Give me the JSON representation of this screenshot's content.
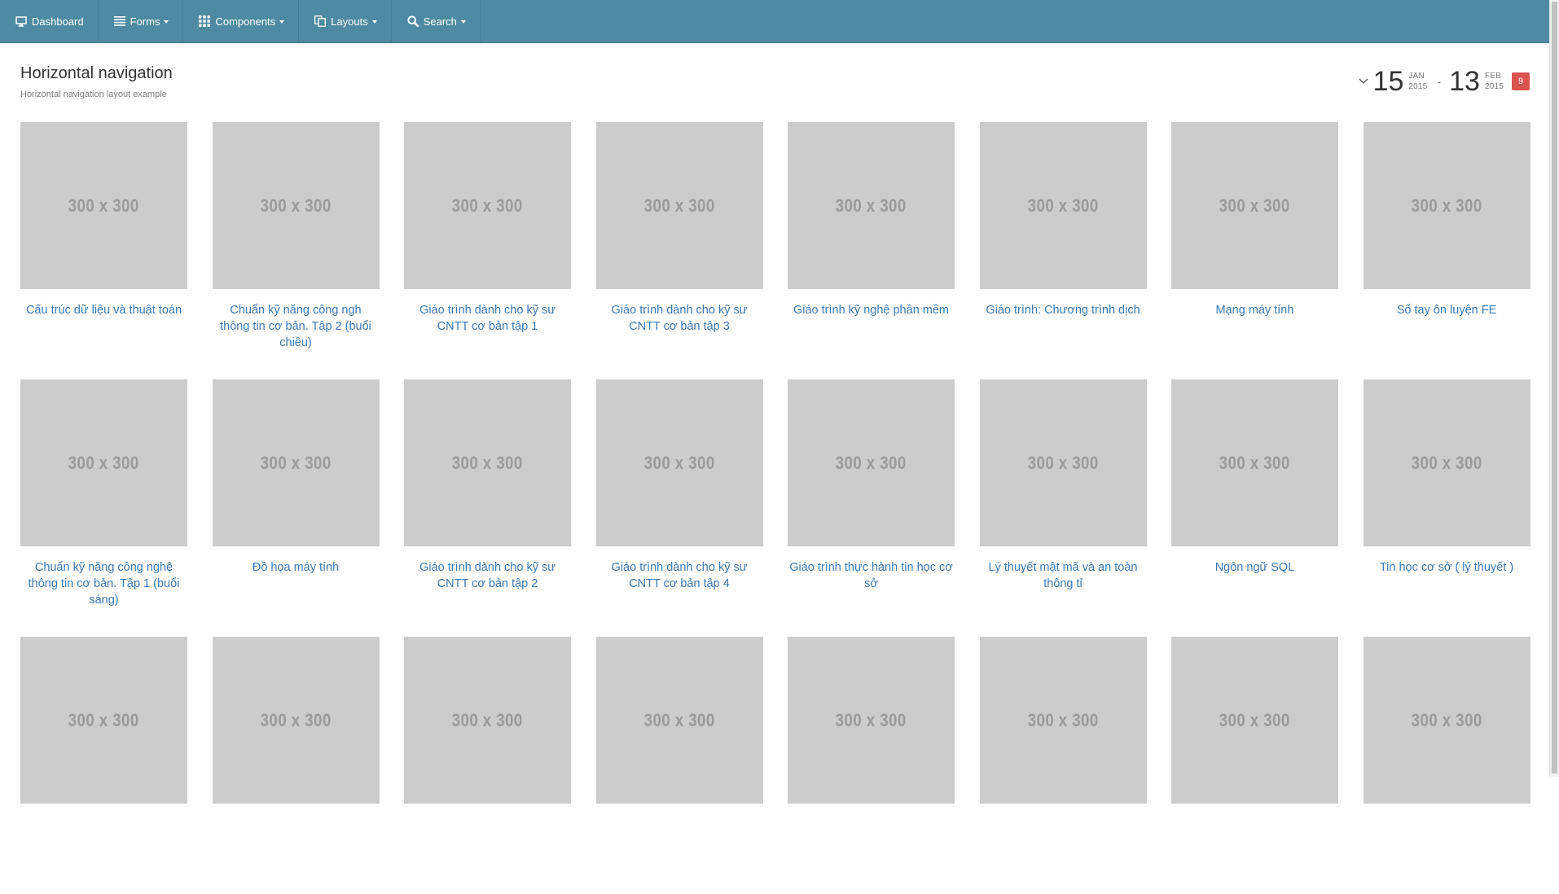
{
  "navbar": {
    "items": [
      {
        "label": "Dashboard",
        "icon": "monitor-icon",
        "dropdown": false
      },
      {
        "label": "Forms",
        "icon": "list-icon",
        "dropdown": true
      },
      {
        "label": "Components",
        "icon": "grid-icon",
        "dropdown": true
      },
      {
        "label": "Layouts",
        "icon": "copy-icon",
        "dropdown": true
      },
      {
        "label": "Search",
        "icon": "search-icon",
        "dropdown": true
      }
    ]
  },
  "header": {
    "title": "Horizontal navigation",
    "subtitle": "Horizontal navigation layout example"
  },
  "daterange": {
    "start_day": "15",
    "start_month": "JAN",
    "start_year": "2015",
    "separator": "-",
    "end_day": "13",
    "end_month": "FEB",
    "end_year": "2015",
    "badge": "9"
  },
  "placeholder_text": "300 x 300",
  "books": [
    "Cấu trúc dữ liệu và thuật toán",
    "Chuẩn kỹ năng công ngh thông tin cơ bản. Tập 2 (buổi chiều)",
    "Giáo trình dành cho kỹ sư CNTT cơ bản tập 1",
    "Giáo trình dành cho kỹ sư CNTT cơ bản tập 3",
    "Giáo trình kỹ nghệ phần mềm",
    "Giáo trình: Chương trình dịch",
    "Mạng máy tính",
    "Sổ tay ôn luyện FE",
    "Chuẩn kỹ năng công nghệ thông tin cơ bản. Tập 1 (buổi sáng)",
    "Đồ họa máy tính",
    "Giáo trình dành cho kỹ sư CNTT cơ bản tập 2",
    "Giáo trình dành cho kỹ sư CNTT cơ bản tập 4",
    "Giáo trình thực hành tin học cơ sở",
    "Lý thuyết mật mã và an toàn thông tỉ",
    "Ngôn ngữ SQL",
    "Tin học cơ sở ( lý thuyết )",
    "",
    "",
    "",
    "",
    "",
    "",
    "",
    ""
  ],
  "colors": {
    "navbar_bg": "#4e8ba2",
    "link": "#3a79b5",
    "placeholder_bg": "#cccccc",
    "badge": "#d9534f"
  }
}
